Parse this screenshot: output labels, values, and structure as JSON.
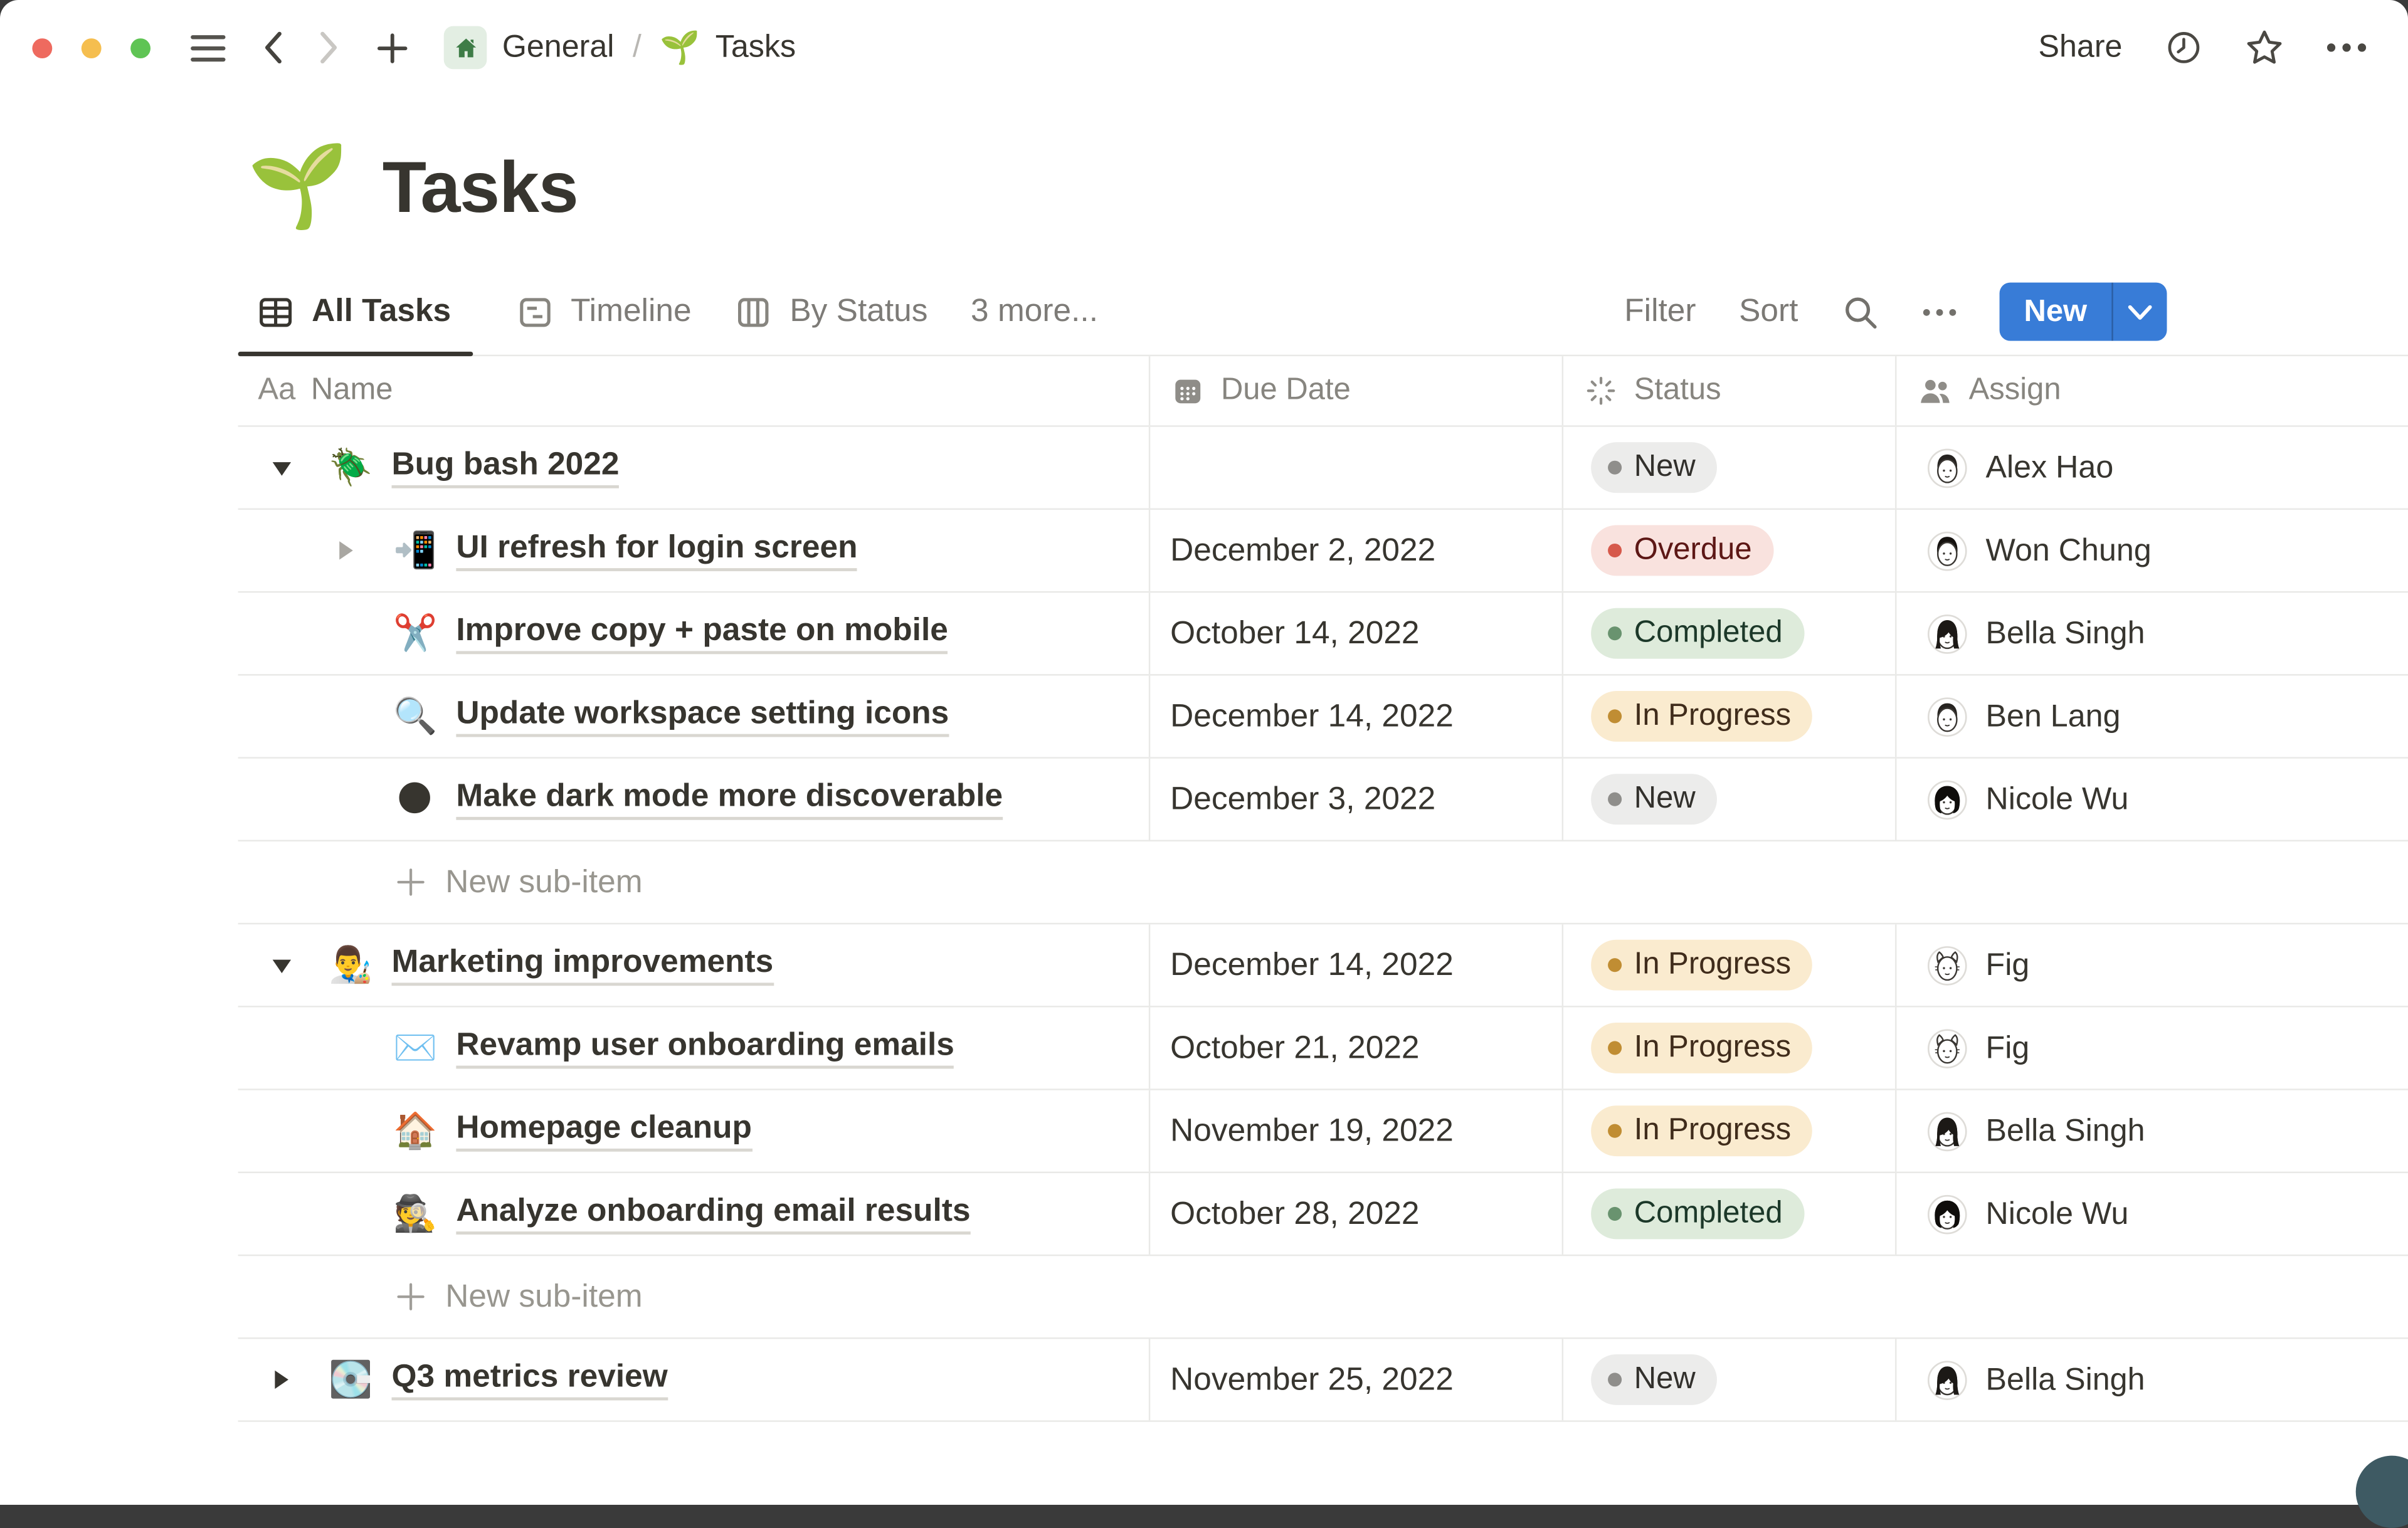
{
  "topbar": {
    "breadcrumb": {
      "root": "General",
      "separator": "/",
      "page_icon": "🌱",
      "page": "Tasks"
    },
    "share_label": "Share"
  },
  "page": {
    "icon": "🌱",
    "title": "Tasks"
  },
  "view_tabs": [
    {
      "label": "All Tasks",
      "icon": "table-icon",
      "active": true
    },
    {
      "label": "Timeline",
      "icon": "timeline-icon",
      "active": false
    },
    {
      "label": "By Status",
      "icon": "board-icon",
      "active": false
    },
    {
      "label": "3 more...",
      "icon": null,
      "active": false
    }
  ],
  "toolbar": {
    "filter_label": "Filter",
    "sort_label": "Sort",
    "new_label": "New",
    "new_button_color": "#387CD7"
  },
  "table": {
    "columns": [
      {
        "key": "name",
        "label": "Name",
        "icon": "Aa"
      },
      {
        "key": "due",
        "label": "Due Date",
        "icon": "calendar-icon"
      },
      {
        "key": "status",
        "label": "Status",
        "icon": "status-spinner-icon"
      },
      {
        "key": "assign",
        "label": "Assign",
        "icon": "people-icon"
      }
    ],
    "rows": [
      {
        "type": "item",
        "level": 0,
        "toggle": "down",
        "toggle_tone": "dark",
        "icon": "🪲",
        "name": "Bug bash 2022",
        "due": "",
        "status": "New",
        "assignee": "Alex Hao",
        "avatar": "man-short-hair"
      },
      {
        "type": "item",
        "level": 1,
        "toggle": "right",
        "toggle_tone": "gray",
        "icon": "📲",
        "name": "UI refresh for login screen",
        "due": "December 2, 2022",
        "status": "Overdue",
        "assignee": "Won Chung",
        "avatar": "man-dark-hair"
      },
      {
        "type": "item",
        "level": 1,
        "toggle": null,
        "icon": "✂️",
        "name": "Improve copy + paste on mobile",
        "due": "October 14, 2022",
        "status": "Completed",
        "assignee": "Bella Singh",
        "avatar": "woman-long-hair"
      },
      {
        "type": "item",
        "level": 1,
        "toggle": null,
        "icon": "🔍",
        "name": "Update workspace setting icons",
        "due": "December 14, 2022",
        "status": "In Progress",
        "assignee": "Ben Lang",
        "avatar": "man-short-hair"
      },
      {
        "type": "item",
        "level": 1,
        "toggle": null,
        "icon": "🌑",
        "name": "Make dark mode more discoverable",
        "due": "December 3, 2022",
        "status": "New",
        "assignee": "Nicole Wu",
        "avatar": "woman-bob"
      },
      {
        "type": "add",
        "label": "New sub-item"
      },
      {
        "type": "item",
        "level": 0,
        "toggle": "down",
        "toggle_tone": "dark",
        "icon": "👨‍🎨",
        "name": "Marketing improvements",
        "due": "December 14, 2022",
        "status": "In Progress",
        "assignee": "Fig",
        "avatar": "animal-face"
      },
      {
        "type": "item",
        "level": 1,
        "toggle": null,
        "icon": "✉️",
        "name": "Revamp user onboarding emails",
        "due": "October 21, 2022",
        "status": "In Progress",
        "assignee": "Fig",
        "avatar": "animal-face"
      },
      {
        "type": "item",
        "level": 1,
        "toggle": null,
        "icon": "🏠",
        "name": "Homepage cleanup",
        "due": "November 19, 2022",
        "status": "In Progress",
        "assignee": "Bella Singh",
        "avatar": "woman-long-hair"
      },
      {
        "type": "item",
        "level": 1,
        "toggle": null,
        "icon": "🕵️",
        "name": "Analyze onboarding email results",
        "due": "October 28, 2022",
        "status": "Completed",
        "assignee": "Nicole Wu",
        "avatar": "woman-bob"
      },
      {
        "type": "add",
        "label": "New sub-item"
      },
      {
        "type": "item",
        "level": 0,
        "toggle": "right",
        "toggle_tone": "dark",
        "icon": "💽",
        "name": "Q3 metrics review",
        "due": "November 25, 2022",
        "status": "New",
        "assignee": "Bella Singh",
        "avatar": "woman-long-hair"
      }
    ]
  },
  "status_styles": {
    "New": {
      "bg": "#ECECEB",
      "dot": "#8F8E8B",
      "text": "#32302C"
    },
    "Overdue": {
      "bg": "#F9E2DE",
      "dot": "#D6594B",
      "text": "#5D1715"
    },
    "Completed": {
      "bg": "#DEEBDB",
      "dot": "#69936F",
      "text": "#1C3829"
    },
    "In Progress": {
      "bg": "#FAEBCF",
      "dot": "#C08D33",
      "text": "#402C1B"
    }
  },
  "colors": {
    "traffic_lights": [
      "#EE6A5F",
      "#F5BE4F",
      "#5FC454"
    ],
    "accent_blue": "#387CD7",
    "table_border": "#E9E9E7",
    "text": "#37352F",
    "muted_text": "#787774",
    "home_badge_bg": "#E3EEE3",
    "home_badge_glyph": "#3E7C47",
    "help_bubble": "#3E5A63"
  }
}
